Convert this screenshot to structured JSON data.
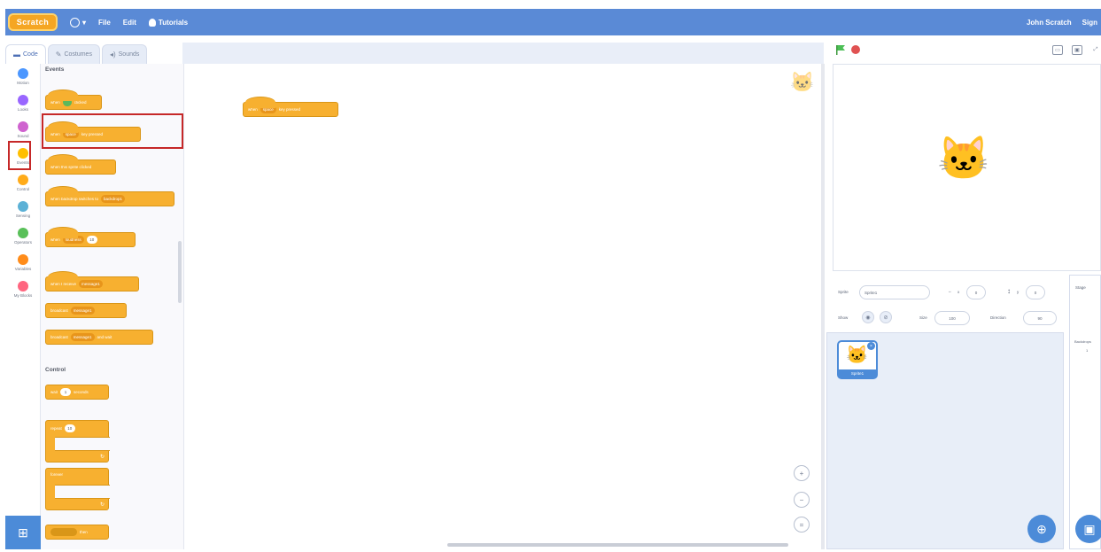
{
  "menubar": {
    "logo": "Scratch",
    "file": "File",
    "edit": "Edit",
    "tutorials": "Tutorials",
    "user": "John Scratch",
    "signout": "Sign"
  },
  "tabs": {
    "code": "Code",
    "costumes": "Costumes",
    "sounds": "Sounds"
  },
  "categories": [
    {
      "label": "Motion",
      "color": "#4c97ff"
    },
    {
      "label": "Looks",
      "color": "#9966ff"
    },
    {
      "label": "Sound",
      "color": "#cf63cf"
    },
    {
      "label": "Events",
      "color": "#ffbf00"
    },
    {
      "label": "Control",
      "color": "#ffab19"
    },
    {
      "label": "Sensing",
      "color": "#5cb1d6"
    },
    {
      "label": "Operators",
      "color": "#59c059"
    },
    {
      "label": "Variables",
      "color": "#ff8c1a"
    },
    {
      "label": "My Blocks",
      "color": "#ff6680"
    }
  ],
  "palette": {
    "events_title": "Events",
    "control_title": "Control",
    "blocks": {
      "when_flag": "when",
      "when_flag_suffix": "clicked",
      "when_key": "when",
      "when_key_slot": "space",
      "when_key_suffix": "key pressed",
      "when_sprite": "when this sprite clicked",
      "when_backdrop": "when backdrop switches to",
      "when_backdrop_slot": "backdrop1",
      "when_loudness": "when",
      "when_loudness_slot": "loudness",
      "when_loudness_value": "10",
      "when_receive": "when I receive",
      "when_receive_slot": "message1",
      "broadcast": "broadcast",
      "broadcast_slot": "message1",
      "broadcast_wait": "broadcast",
      "broadcast_wait_slot": "message1",
      "broadcast_wait_suffix": "and wait",
      "wait": "wait",
      "wait_value": "1",
      "wait_suffix": "seconds",
      "repeat": "repeat",
      "repeat_value": "10",
      "forever": "forever",
      "if_then": "then"
    }
  },
  "workspace": {
    "script": "when",
    "script_slot": "space",
    "script_suffix": "key pressed",
    "zoom_in": "+",
    "zoom_out": "−",
    "zoom_reset": "="
  },
  "sprite_info": {
    "sprite_label": "Sprite",
    "sprite_name": "Sprite1",
    "x_label": "x",
    "x_value": "0",
    "y_label": "y",
    "y_value": "0",
    "show_label": "Show",
    "size_label": "Size",
    "size_value": "100",
    "direction_label": "Direction",
    "direction_value": "90"
  },
  "sprite_list": {
    "sprite1": "Sprite1"
  },
  "stage_panel": {
    "title": "Stage",
    "backdrops_label": "Backdrops",
    "backdrops_count": "1"
  },
  "colors": {
    "menubar": "#5a8ad6",
    "events_block": "#f7b030",
    "highlight": "#c62828",
    "accent": "#4c8bd8"
  }
}
